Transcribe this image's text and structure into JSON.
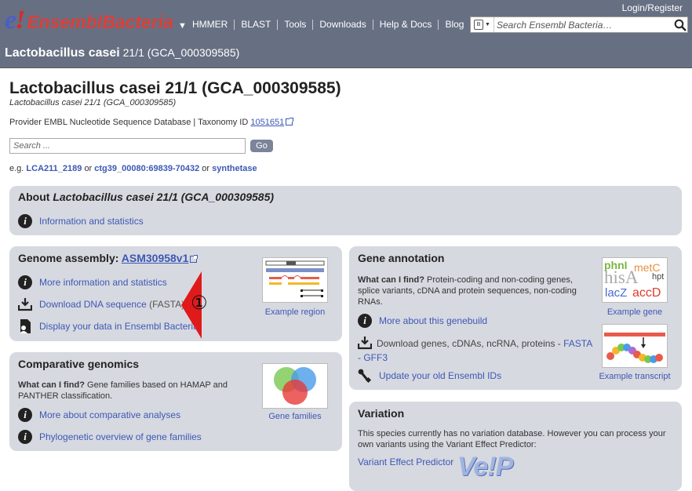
{
  "header": {
    "login": "Login/Register",
    "logo_e": "e",
    "logo_bang": "!",
    "logo_text": "EnsemblBacteria",
    "logo_caret": "▼",
    "nav": [
      "HMMER",
      "BLAST",
      "Tools",
      "Downloads",
      "Help & Docs",
      "Blog"
    ],
    "search_placeholder": "Search Ensembl Bacteria…",
    "site_icon_letter": "B",
    "species_name": "Lactobacillus casei",
    "species_rest": "21/1 (GCA_000309585)"
  },
  "page": {
    "title": "Lactobacillus casei 21/1 (GCA_000309585)",
    "subtitle": "Lactobacillus casei 21/1 (GCA_000309585)",
    "provider_text": "Provider EMBL Nucleotide Sequence Database | Taxonomy ID",
    "taxonomy_id": "1051651",
    "search_placeholder": "Search ...",
    "go_label": "Go",
    "eg_prefix": "e.g.",
    "eg_links": [
      "LCA211_2189",
      "ctg39_00080:69839-70432",
      "synthetase"
    ],
    "eg_or": "or"
  },
  "about": {
    "heading_prefix": "About",
    "heading_species": "Lactobacillus casei 21/1 (GCA_000309585)",
    "link": "Information and statistics"
  },
  "genome": {
    "heading": "Genome assembly:",
    "assembly": "ASM30958v1",
    "more_link": "More information and statistics",
    "download_link": "Download DNA sequence",
    "download_suffix": "(FASTA)",
    "display_link": "Display your data in Ensembl Bacteria",
    "example_caption": "Example region"
  },
  "marker": {
    "label": "①",
    "color": "#e01a1a"
  },
  "comparative": {
    "heading": "Comparative genomics",
    "what_label": "What can I find?",
    "what_text": "Gene families based on HAMAP and PANTHER classification.",
    "more_link": "More about comparative analyses",
    "phylo_link": "Phylogenetic overview of gene families",
    "caption": "Gene families"
  },
  "annotation": {
    "heading": "Gene annotation",
    "what_label": "What can I find?",
    "what_text": "Protein-coding and non-coding genes, splice variants, cDNA and protein sequences, non-coding RNAs.",
    "more_link": "More about this genebuild",
    "download_text": "Download genes, cDNAs, ncRNA, proteins -",
    "fasta": "FASTA",
    "gff3": "GFF3",
    "update_link": "Update your old Ensembl IDs",
    "example_gene": "Example gene",
    "example_transcript": "Example transcript",
    "gene_words": [
      "phnI",
      "metC",
      "hisA",
      "hpt",
      "lacZ",
      "accD"
    ]
  },
  "variation": {
    "heading": "Variation",
    "text": "This species currently has no variation database. However you can process your own variants using the Variant Effect Predictor:",
    "link": "Variant Effect Predictor",
    "vep_logo": "Ve!P"
  },
  "colors": {
    "masthead": "#676f82",
    "panel": "#d7d9e0",
    "link": "#3c58b5",
    "logo_red": "#d9403a",
    "logo_blue": "#4a5ec5"
  }
}
